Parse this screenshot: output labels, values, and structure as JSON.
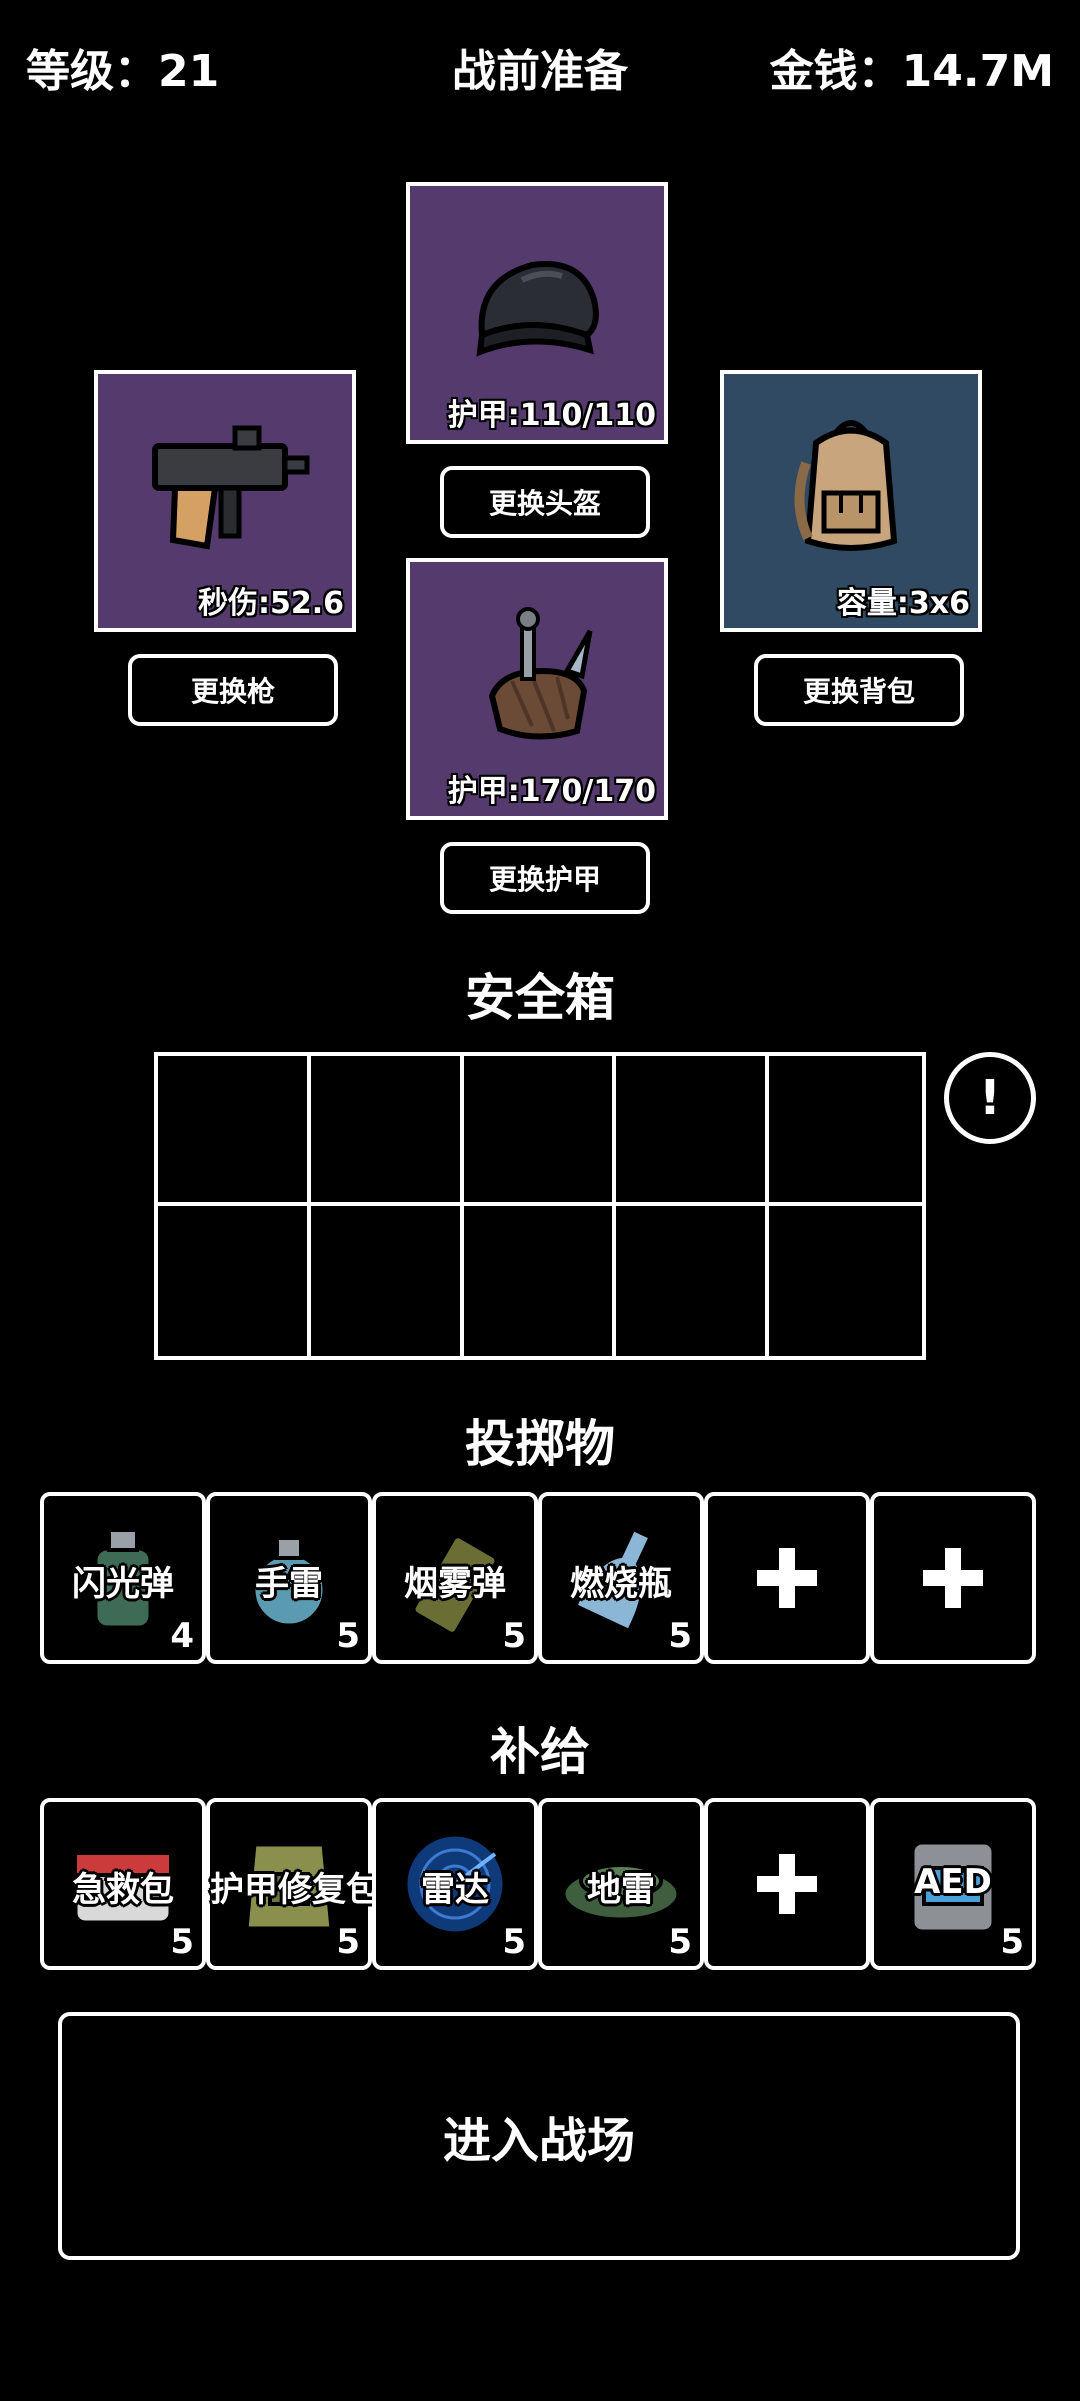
{
  "header": {
    "level": "等级：21",
    "title": "战前准备",
    "money": "金钱：14.7M"
  },
  "equipment": {
    "helmet": {
      "stat": "护甲:110/110",
      "button": "更换头盔",
      "icon": "beanie-hat-icon"
    },
    "gun": {
      "stat": "秒伤:52.6",
      "button": "更换枪",
      "icon": "uzi-gun-icon"
    },
    "armor": {
      "stat": "护甲:170/170",
      "button": "更换护甲",
      "icon": "vest-armor-icon"
    },
    "backpack": {
      "stat": "容量:3x6",
      "button": "更换背包",
      "icon": "backpack-icon"
    }
  },
  "safe_box": {
    "title": "安全箱",
    "info": "!"
  },
  "throwables": {
    "title": "投掷物",
    "items": [
      {
        "name": "闪光弹",
        "count": "4",
        "icon": "flashbang-icon"
      },
      {
        "name": "手雷",
        "count": "5",
        "icon": "grenade-icon"
      },
      {
        "name": "烟雾弹",
        "count": "5",
        "icon": "smoke-grenade-icon"
      },
      {
        "name": "燃烧瓶",
        "count": "5",
        "icon": "molotov-icon"
      }
    ]
  },
  "supplies": {
    "title": "补给",
    "items": [
      {
        "name": "急救包",
        "count": "5",
        "icon": "medkit-icon"
      },
      {
        "name": "护甲修复包",
        "count": "5",
        "icon": "armor-repair-kit-icon"
      },
      {
        "name": "雷达",
        "count": "5",
        "icon": "radar-icon"
      },
      {
        "name": "地雷",
        "count": "5",
        "icon": "landmine-icon"
      },
      {
        "name": "AED",
        "count": "5",
        "icon": "aed-icon"
      }
    ]
  },
  "enter_button": "进入战场"
}
